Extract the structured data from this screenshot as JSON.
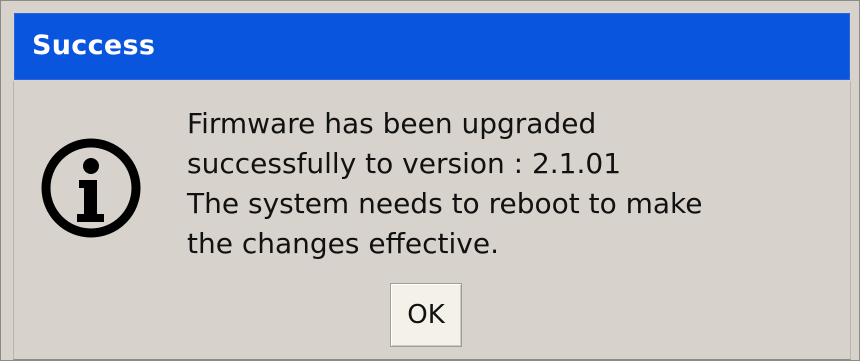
{
  "dialog": {
    "title": "Success",
    "icon": "info-icon",
    "message_lines": [
      "Firmware has been upgraded",
      "successfully to version : 2.1.01",
      "The system needs to reboot to make",
      "the changes effective."
    ],
    "ok_label": "OK"
  },
  "colors": {
    "titlebar": "#0a55dd",
    "background": "#d7d3cc",
    "button": "#f4f1e8"
  }
}
